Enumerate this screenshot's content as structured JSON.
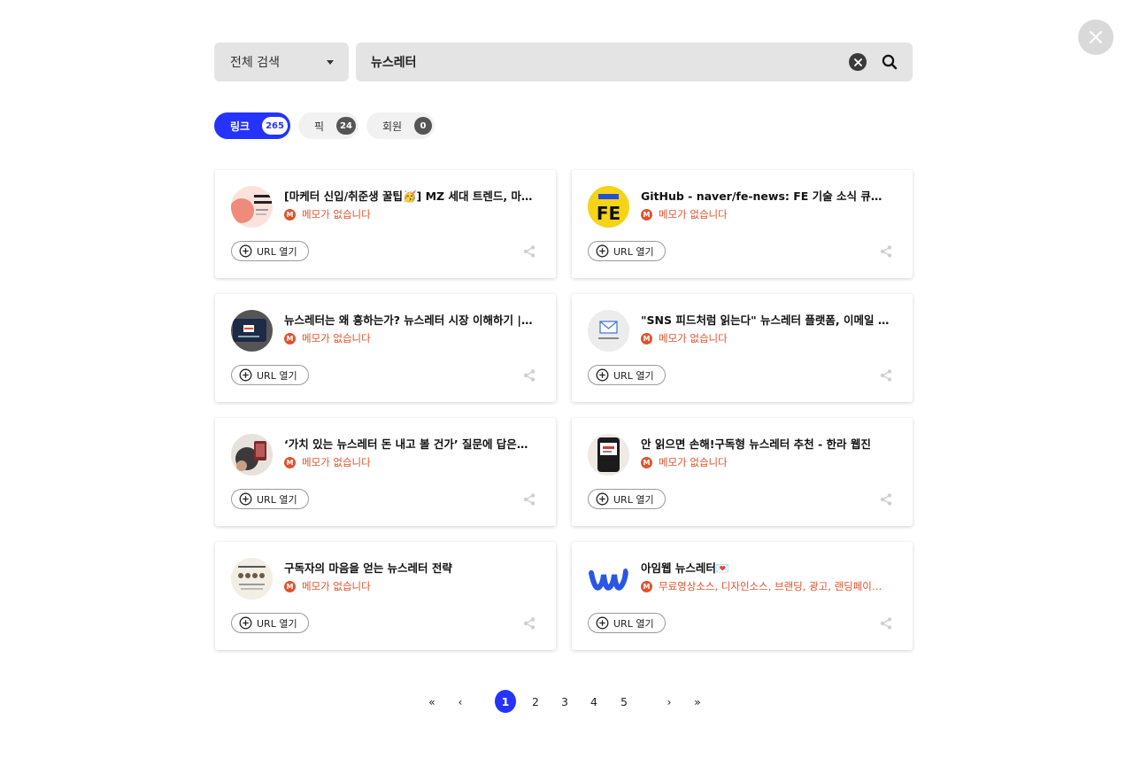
{
  "close": {
    "icon": "close-icon"
  },
  "search": {
    "scope_label": "전체 검색",
    "query": "뉴스레터",
    "clear_icon": "clear-icon",
    "search_icon": "search-icon"
  },
  "tabs": [
    {
      "label": "링크",
      "count": "265",
      "active": true
    },
    {
      "label": "픽",
      "count": "24",
      "active": false
    },
    {
      "label": "회원",
      "count": "0",
      "active": false
    }
  ],
  "cards": [
    {
      "title": "[마케터 신입/취준생 꿀팁🥳] MZ 세대 트렌드, 마케터를 위한 뉴스레터 추천",
      "memo": "메모가 없습니다",
      "url_label": "URL 열기"
    },
    {
      "title": "GitHub - naver/fe-news: FE 기술 소식 큐레이션 뉴스레터",
      "memo": "메모가 없습니다",
      "url_label": "URL 열기"
    },
    {
      "title": "뉴스레터는 왜 흥하는가? 뉴스레터 시장 이해하기 | 요즘IT",
      "memo": "메모가 없습니다",
      "url_label": "URL 열기"
    },
    {
      "title": "\"SNS 피드처럼 읽는다\" 뉴스레터 플랫폼, 이메일 문법을 바꾸다",
      "memo": "메모가 없습니다",
      "url_label": "URL 열기"
    },
    {
      "title": "‘가치 있는 뉴스레터 돈 내고 볼 건가’ 질문에 답은? < IT 뉴스",
      "memo": "메모가 없습니다",
      "url_label": "URL 열기"
    },
    {
      "title": "안 읽으면 손해!구독형 뉴스레터 추천 - 한라 웹진",
      "memo": "메모가 없습니다",
      "url_label": "URL 열기"
    },
    {
      "title": "구독자의 마음을 얻는 뉴스레터 전략",
      "memo": "메모가 없습니다",
      "url_label": "URL 열기"
    },
    {
      "title": "아임웹 뉴스레터💌",
      "memo": "무료영상소스, 디자인소스, 브랜딩, 광고, 랜딩페이지 제작 팁",
      "url_label": "URL 열기"
    }
  ],
  "pagination": {
    "first": "«",
    "prev": "‹",
    "pages": [
      "1",
      "2",
      "3",
      "4",
      "5"
    ],
    "current": "1",
    "next": "›",
    "last": "»"
  },
  "colors": {
    "accent": "#2433ff",
    "memo": "#e0522b"
  }
}
